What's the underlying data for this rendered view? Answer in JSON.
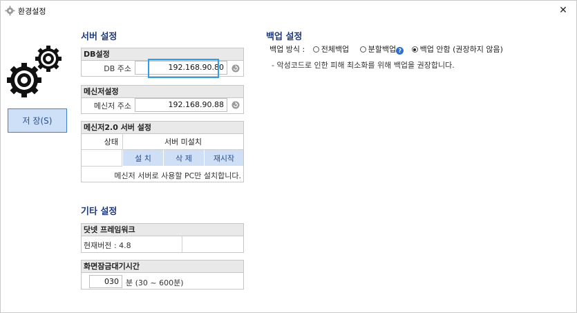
{
  "window": {
    "title": "환경설정",
    "close_symbol": "✕"
  },
  "left": {
    "save_label": "저 장(S)"
  },
  "server_settings": {
    "title": "서버 설정",
    "db": {
      "header": "DB설정",
      "label": "DB 주소",
      "value": "192.168.90.80"
    },
    "messenger": {
      "header": "메신저설정",
      "label": "메신저 주소",
      "value": "192.168.90.88"
    },
    "messenger2": {
      "header": "메신저2.0 서버 설정",
      "status_label": "상태",
      "status_value": "서버 미설치",
      "install_label": "설 치",
      "delete_label": "삭 제",
      "restart_label": "재시작",
      "note": "메신저 서버로 사용할 PC만 설치합니다."
    }
  },
  "other_settings": {
    "title": "기타 설정",
    "dotnet": {
      "header": "닷넷 프레임워크",
      "current_version": "현재버전 : 4.8"
    },
    "screen_lock": {
      "header": "화면잠금대기시간",
      "value": "030",
      "unit_text": "분 (30 ~ 600분)"
    }
  },
  "backup_settings": {
    "title": "백업 설정",
    "mode_label": "백업 방식 :",
    "options": [
      {
        "label": "전체백업",
        "selected": false
      },
      {
        "label": "분할백업",
        "selected": false
      },
      {
        "label": "백업 안함 (권장하지 않음)",
        "selected": true
      }
    ],
    "help_symbol": "?",
    "note": "- 악성코드로 인한 피해 최소화를 위해 백업을 권장합니다."
  }
}
